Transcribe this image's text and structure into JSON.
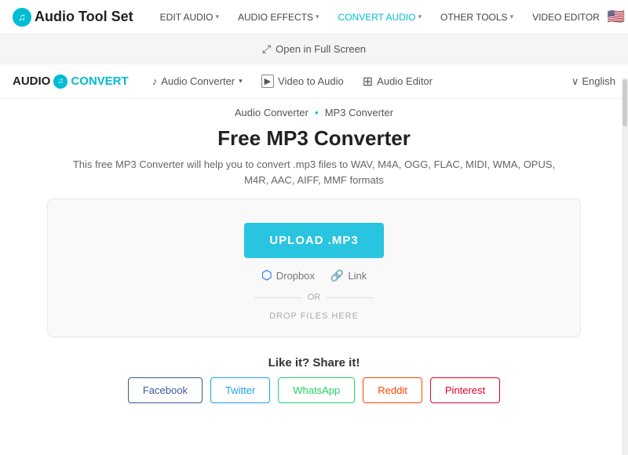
{
  "app": {
    "name": "Audio Tool Set",
    "logo_icon": "♫"
  },
  "top_nav": {
    "items": [
      {
        "label": "EDIT AUDIO",
        "has_caret": true,
        "active": false
      },
      {
        "label": "AUDIO EFFECTS",
        "has_caret": true,
        "active": false
      },
      {
        "label": "CONVERT AUDIO",
        "has_caret": true,
        "active": true
      },
      {
        "label": "OTHER TOOLS",
        "has_caret": true,
        "active": false
      },
      {
        "label": "VIDEO EDITOR",
        "has_caret": false,
        "active": false
      }
    ],
    "flag": "🇺🇸"
  },
  "fullscreen_bar": {
    "label": "Open in Full Screen"
  },
  "sub_nav": {
    "logo_text": "AUDIOCONVERT",
    "logo_icon": "♫",
    "items": [
      {
        "icon": "♪",
        "label": "Audio Converter",
        "has_caret": true
      },
      {
        "icon": "▶",
        "label": "Video to Audio",
        "has_caret": false
      },
      {
        "icon": "≡",
        "label": "Audio Editor",
        "has_caret": false
      }
    ],
    "language": "English",
    "language_caret": "∨"
  },
  "breadcrumb": {
    "link": "Audio Converter",
    "current": "MP3 Converter"
  },
  "main": {
    "title": "Free MP3 Converter",
    "description": "This free MP3 Converter will help you to convert .mp3 files to WAV, M4A, OGG, FLAC, MIDI, WMA, OPUS, M4R, AAC, AIFF, MMF formats",
    "upload_btn": "UPLOAD .MP3",
    "dropbox_label": "Dropbox",
    "link_label": "Link",
    "or_label": "OR",
    "drop_label": "DROP FILES HERE"
  },
  "share": {
    "title": "Like it? Share it!",
    "buttons": [
      {
        "label": "Facebook",
        "class": "fb-btn"
      },
      {
        "label": "Twitter",
        "class": "tw-btn"
      },
      {
        "label": "WhatsApp",
        "class": "wa-btn"
      },
      {
        "label": "Reddit",
        "class": "rd-btn"
      },
      {
        "label": "Pinterest",
        "class": "pi-btn"
      }
    ]
  }
}
